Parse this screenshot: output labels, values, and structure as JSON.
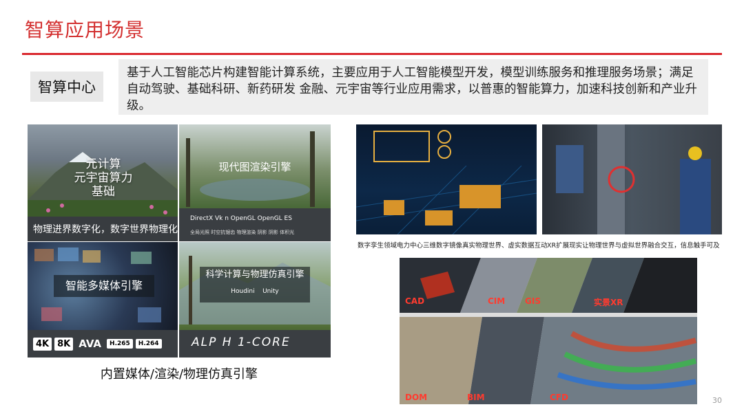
{
  "header": {
    "title": "智算应用场景"
  },
  "intro": {
    "tag": "智算中心",
    "text": "基于人工智能芯片构建智能计算系统，主要应用于人工智能模型开发，模型训练服务和推理服务场景；满足自动驾驶、基础科研、新药研发 金融、元宇宙等行业应用需求，以普惠的智能算力，加速科技创新和产业升级。"
  },
  "left_grid": {
    "panel1": {
      "line1": "元计算",
      "line2": "元宇宙算力",
      "line3": "基础",
      "strip": "物理进界数字化，数字世界物理化"
    },
    "panel2": {
      "label": "现代图渲染引擎",
      "logos": "DirectX  Vk  n  OpenGL  OpenGL ES",
      "sub": "全局光照  时空抗锯齿  物理渲染  阴影  阴影  体积光"
    },
    "panel3": {
      "label": "智能多媒体引擎",
      "badges": [
        "4K",
        "8K",
        "AVA",
        "H.265",
        "H.264"
      ]
    },
    "panel4": {
      "label": "科学计算与物理仿真引擎",
      "tools": [
        "Houdini",
        "Unity"
      ],
      "brand": "ALP H 1-CORE"
    },
    "caption": "内置媒体/渲染/物理仿真引擎"
  },
  "right_top": {
    "caption_left": "数字孪生领域电力中心三维数字镜像真实物理世界、虚实数据互动",
    "caption_right": "XR扩展现实让物理世界与虚拟世界融合交互，信息触手可及"
  },
  "right_bottom": {
    "labels": [
      "CAD",
      "CIM",
      "GIS",
      "实景XR",
      "DOM",
      "BIM",
      "CFD"
    ]
  },
  "page_number": "30"
}
